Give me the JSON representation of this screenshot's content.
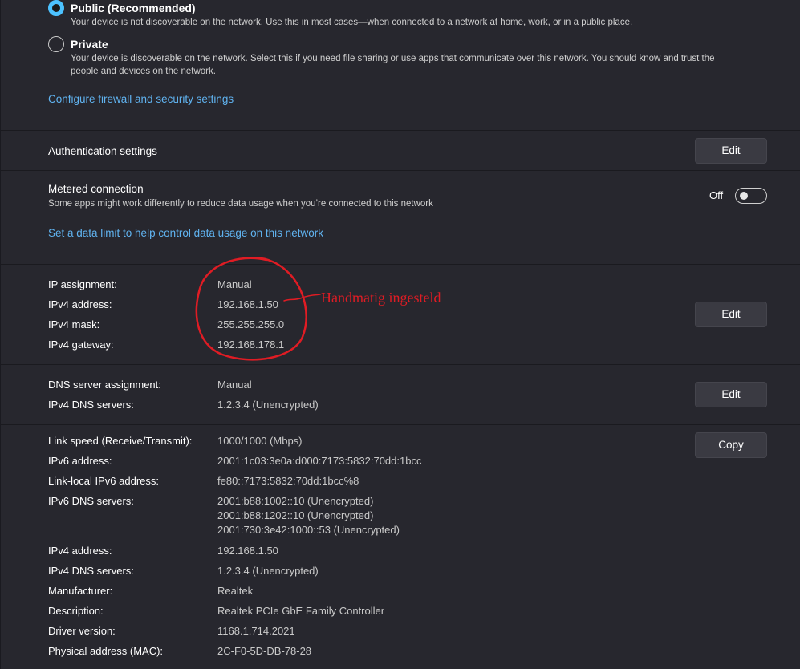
{
  "network_profile": {
    "options": [
      {
        "label": "Public (Recommended)",
        "description": "Your device is not discoverable on the network. Use this in most cases—when connected to a network at home, work, or in a public place.",
        "selected": true
      },
      {
        "label": "Private",
        "description_line1": "Your device is discoverable on the network. Select this if you need file sharing or use apps that communicate over this network. You should know and trust the",
        "description_line2": "people and devices on the network.",
        "selected": false
      }
    ],
    "firewall_link": "Configure firewall and security settings"
  },
  "authentication": {
    "title": "Authentication settings",
    "button": "Edit"
  },
  "metered": {
    "title": "Metered connection",
    "description": "Some apps might work differently to reduce data usage when you’re connected to this network",
    "toggle_label": "Off",
    "toggle_on": false,
    "data_limit_link": "Set a data limit to help control data usage on this network"
  },
  "ip_settings": {
    "rows": [
      {
        "label": "IP assignment:",
        "value": "Manual"
      },
      {
        "label": "IPv4 address:",
        "value": "192.168.1.50"
      },
      {
        "label": "IPv4 mask:",
        "value": "255.255.255.0"
      },
      {
        "label": "IPv4 gateway:",
        "value": "192.168.178.1"
      }
    ],
    "button": "Edit",
    "annotation": "Handmatig ingesteld",
    "annotation_color": "#e01c24"
  },
  "dns_settings": {
    "rows": [
      {
        "label": "DNS server assignment:",
        "value": "Manual"
      },
      {
        "label": "IPv4 DNS servers:",
        "value": "1.2.3.4 (Unencrypted)"
      }
    ],
    "button": "Edit"
  },
  "properties": {
    "button": "Copy",
    "rows": [
      {
        "label": "Link speed (Receive/Transmit):",
        "value": "1000/1000 (Mbps)"
      },
      {
        "label": "IPv6 address:",
        "value": "2001:1c03:3e0a:d000:7173:5832:70dd:1bcc"
      },
      {
        "label": "Link-local IPv6 address:",
        "value": "fe80::7173:5832:70dd:1bcc%8"
      },
      {
        "label": "IPv6 DNS servers:",
        "values": [
          "2001:b88:1002::10 (Unencrypted)",
          "2001:b88:1202::10 (Unencrypted)",
          "2001:730:3e42:1000::53 (Unencrypted)"
        ]
      },
      {
        "label": "IPv4 address:",
        "value": "192.168.1.50"
      },
      {
        "label": "IPv4 DNS servers:",
        "value": "1.2.3.4 (Unencrypted)"
      },
      {
        "label": "Manufacturer:",
        "value": "Realtek"
      },
      {
        "label": "Description:",
        "value": "Realtek PCIe GbE Family Controller"
      },
      {
        "label": "Driver version:",
        "value": "1168.1.714.2021"
      },
      {
        "label": "Physical address (MAC):",
        "value": "2C-F0-5D-DB-78-28"
      }
    ]
  },
  "colors": {
    "accent": "#4cc2ff",
    "link": "#60b3f0",
    "background": "#27272e"
  }
}
